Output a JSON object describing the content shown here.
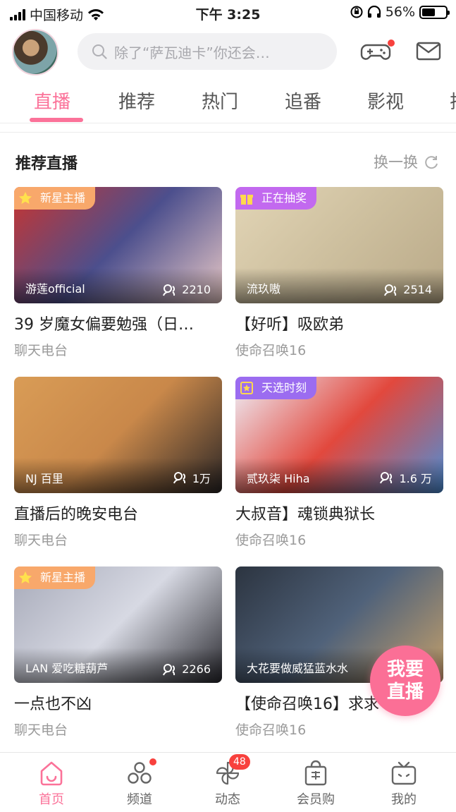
{
  "status_bar": {
    "carrier": "中国移动",
    "time": "下午 3:25",
    "battery": "56%",
    "battery_level": 0.56
  },
  "header": {
    "search_placeholder": "除了“萨瓦迪卡”你还会…",
    "game_has_dot": true
  },
  "tabs": [
    {
      "label": "直播",
      "active": true
    },
    {
      "label": "推荐",
      "active": false
    },
    {
      "label": "热门",
      "active": false
    },
    {
      "label": "追番",
      "active": false
    },
    {
      "label": "影视",
      "active": false
    },
    {
      "label": "排",
      "active": false
    }
  ],
  "section": {
    "title": "推荐直播",
    "refresh_label": "换一换"
  },
  "cards": [
    {
      "badge": "新星主播",
      "badge_type": "star",
      "host": "游莲official",
      "views": "2210",
      "title": "39 岁魔女偏要勉强（日…",
      "category": "聊天电台",
      "thumb_colors": [
        "#c9342f",
        "#4c4f8d",
        "#e9c9c7"
      ]
    },
    {
      "badge": "正在抽奖",
      "badge_type": "gift",
      "host": "流玖嗷",
      "views": "2514",
      "title": "【好听】吸欧弟",
      "category": "使命召唤16",
      "thumb_colors": [
        "#e2d5b6",
        "#cdbf9e",
        "#b9a988"
      ]
    },
    {
      "badge": "",
      "badge_type": "",
      "host": "NJ 百里",
      "views": "1万",
      "title": "直播后的晚安电台",
      "category": "聊天电台",
      "thumb_colors": [
        "#d99c56",
        "#c9884a",
        "#2b2626"
      ]
    },
    {
      "badge": "天选时刻",
      "badge_type": "event",
      "host": "贰玖柒 Hiha",
      "views": "1.6 万",
      "title": "大叔音】魂锁典狱长",
      "category": "使命召唤16",
      "thumb_colors": [
        "#eef2fb",
        "#e2483d",
        "#4c8fd8"
      ]
    },
    {
      "badge": "新星主播",
      "badge_type": "star",
      "host": "LAN 爱吃糖葫芦",
      "views": "2266",
      "title": "一点也不凶",
      "category": "聊天电台",
      "thumb_colors": [
        "#a7aab9",
        "#d7d9e3",
        "#2a2a30"
      ]
    },
    {
      "badge": "",
      "badge_type": "",
      "host": "大花要做威猛蓝水水",
      "views": "",
      "title": "【使命召唤16】求求",
      "category": "使命召唤16",
      "thumb_colors": [
        "#2c3440",
        "#50627a",
        "#c4a06b"
      ]
    }
  ],
  "fab": {
    "line1": "我要",
    "line2": "直播"
  },
  "bottom_nav": [
    {
      "label": "首页",
      "active": true,
      "dot": false,
      "count": ""
    },
    {
      "label": "频道",
      "active": false,
      "dot": true,
      "count": ""
    },
    {
      "label": "动态",
      "active": false,
      "dot": false,
      "count": "48"
    },
    {
      "label": "会员购",
      "active": false,
      "dot": false,
      "count": ""
    },
    {
      "label": "我的",
      "active": false,
      "dot": false,
      "count": ""
    }
  ],
  "colors": {
    "accent": "#fb7299",
    "badge_star": "#f8a86b",
    "badge_gift": "#c269ef",
    "badge_event": "#9b6cf0"
  }
}
